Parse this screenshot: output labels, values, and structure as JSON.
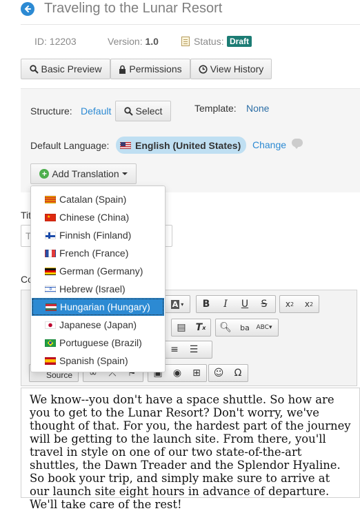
{
  "header": {
    "title": "Traveling to the Lunar Resort"
  },
  "meta": {
    "id_label": "ID:",
    "id_value": "12203",
    "version_label": "Version:",
    "version_value": "1.0",
    "status_label": "Status:",
    "status_value": "Draft"
  },
  "tabs": [
    {
      "label": "Basic Preview",
      "icon": "search-icon"
    },
    {
      "label": "Permissions",
      "icon": "lock-icon"
    },
    {
      "label": "View History",
      "icon": "clock-icon"
    }
  ],
  "settings": {
    "structure_label": "Structure:",
    "structure_value": "Default",
    "select_button": "Select",
    "template_label": "Template:",
    "template_value": "None",
    "default_language_label": "Default Language:",
    "default_language_value": "English (United States)",
    "change_link": "Change",
    "add_translation_button": "Add Translation"
  },
  "background_form": {
    "title_fragment": "Tit",
    "input_fragment": "T",
    "content_fragment": "Co",
    "toolbar_source": "Source"
  },
  "translation_menu": [
    {
      "label": "Catalan (Spain)",
      "flag": "catalan"
    },
    {
      "label": "Chinese (China)",
      "flag": "china"
    },
    {
      "label": "Finnish (Finland)",
      "flag": "finland"
    },
    {
      "label": "French (France)",
      "flag": "france"
    },
    {
      "label": "German (Germany)",
      "flag": "germany"
    },
    {
      "label": "Hebrew (Israel)",
      "flag": "israel"
    },
    {
      "label": "Hungarian (Hungary)",
      "flag": "hungary",
      "selected": true
    },
    {
      "label": "Japanese (Japan)",
      "flag": "japan"
    },
    {
      "label": "Portuguese (Brazil)",
      "flag": "brazil"
    },
    {
      "label": "Spanish (Spain)",
      "flag": "spain"
    }
  ],
  "editor": {
    "content": "We know--you don't have a space shuttle. So how are you to get to the Lunar Resort? Don't worry, we've thought of that. For you, the hardest part of the journey will be getting to the launch site. From there, you'll travel in style on one of our two state-of-the-art shuttles, the Dawn Treader and the Splendor Hyaline. So book your trip, and simply make sure to arrive at our launch site eight hours in advance of departure. We'll take care of the rest!"
  },
  "colors": {
    "accent": "#2c8ad3",
    "draft_badge": "#1c7c74",
    "selected_item": "#2c8ad3"
  }
}
